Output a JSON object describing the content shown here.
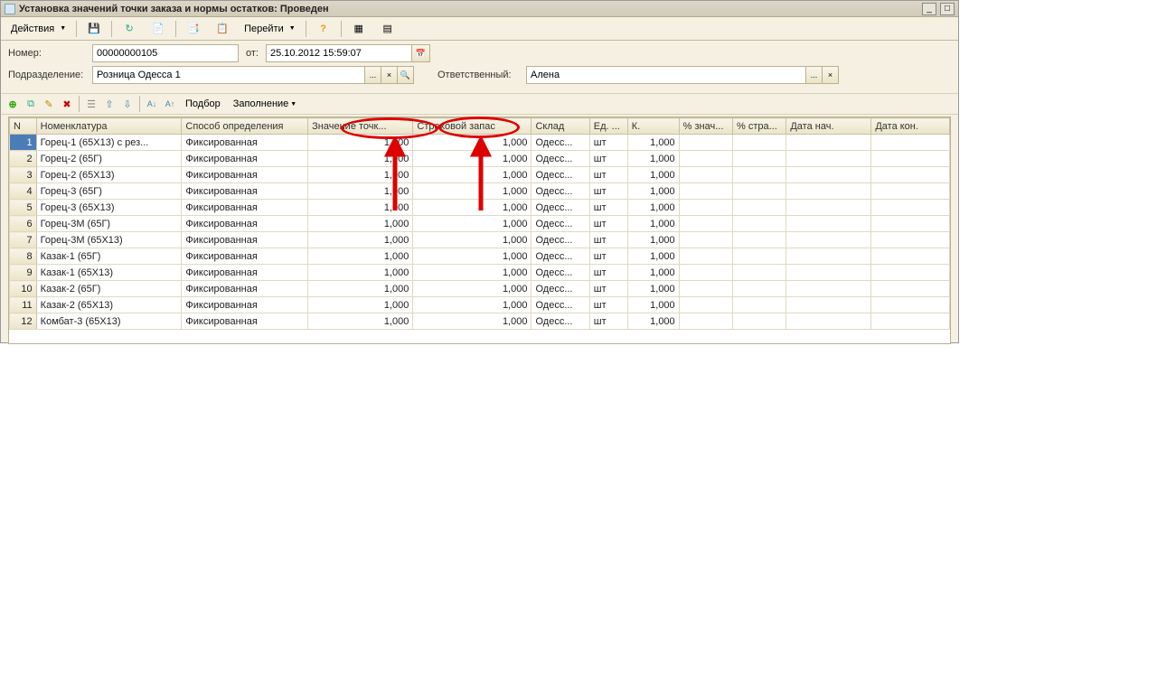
{
  "window": {
    "title": "Установка значений точки заказа и нормы остатков: Проведен"
  },
  "toolbar": {
    "actions": "Действия"
  },
  "switch_label": "Перейти",
  "form": {
    "number_label": "Номер:",
    "number_value": "00000000105",
    "from_label": "от:",
    "date_value": "25.10.2012 15:59:07",
    "division_label": "Подразделение:",
    "division_value": "Розница Одесса 1",
    "responsible_label": "Ответственный:",
    "responsible_value": "Алена"
  },
  "subtoolbar": {
    "pick": "Подбор",
    "fill": "Заполнение"
  },
  "table": {
    "columns": [
      "N",
      "Номенклатура",
      "Способ определения",
      "Значение точк...",
      "Страховой запас",
      "Склад",
      "Ед. ...",
      "К.",
      "% знач...",
      "% стра...",
      "Дата нач.",
      "Дата кон."
    ],
    "rows": [
      {
        "n": "1",
        "nom": "Горец-1 (65X13) с рез...",
        "method": "Фиксированная",
        "val": "1,000",
        "reserve": "1,000",
        "warehouse": "Одесс...",
        "unit": "шт",
        "k": "1,000"
      },
      {
        "n": "2",
        "nom": "Горец-2 (65Г)",
        "method": "Фиксированная",
        "val": "1,000",
        "reserve": "1,000",
        "warehouse": "Одесс...",
        "unit": "шт",
        "k": "1,000"
      },
      {
        "n": "3",
        "nom": "Горец-2 (65X13)",
        "method": "Фиксированная",
        "val": "1,000",
        "reserve": "1,000",
        "warehouse": "Одесс...",
        "unit": "шт",
        "k": "1,000"
      },
      {
        "n": "4",
        "nom": "Горец-3 (65Г)",
        "method": "Фиксированная",
        "val": "1,000",
        "reserve": "1,000",
        "warehouse": "Одесс...",
        "unit": "шт",
        "k": "1,000"
      },
      {
        "n": "5",
        "nom": "Горец-3 (65X13)",
        "method": "Фиксированная",
        "val": "1,000",
        "reserve": "1,000",
        "warehouse": "Одесс...",
        "unit": "шт",
        "k": "1,000"
      },
      {
        "n": "6",
        "nom": "Горец-3М (65Г)",
        "method": "Фиксированная",
        "val": "1,000",
        "reserve": "1,000",
        "warehouse": "Одесс...",
        "unit": "шт",
        "k": "1,000"
      },
      {
        "n": "7",
        "nom": "Горец-3М (65X13)",
        "method": "Фиксированная",
        "val": "1,000",
        "reserve": "1,000",
        "warehouse": "Одесс...",
        "unit": "шт",
        "k": "1,000"
      },
      {
        "n": "8",
        "nom": "Казак-1 (65Г)",
        "method": "Фиксированная",
        "val": "1,000",
        "reserve": "1,000",
        "warehouse": "Одесс...",
        "unit": "шт",
        "k": "1,000"
      },
      {
        "n": "9",
        "nom": "Казак-1 (65X13)",
        "method": "Фиксированная",
        "val": "1,000",
        "reserve": "1,000",
        "warehouse": "Одесс...",
        "unit": "шт",
        "k": "1,000"
      },
      {
        "n": "10",
        "nom": "Казак-2 (65Г)",
        "method": "Фиксированная",
        "val": "1,000",
        "reserve": "1,000",
        "warehouse": "Одесс...",
        "unit": "шт",
        "k": "1,000"
      },
      {
        "n": "11",
        "nom": "Казак-2 (65X13)",
        "method": "Фиксированная",
        "val": "1,000",
        "reserve": "1,000",
        "warehouse": "Одесс...",
        "unit": "шт",
        "k": "1,000"
      },
      {
        "n": "12",
        "nom": "Комбат-3 (65X13)",
        "method": "Фиксированная",
        "val": "1,000",
        "reserve": "1,000",
        "warehouse": "Одесс...",
        "unit": "шт",
        "k": "1,000"
      }
    ]
  }
}
